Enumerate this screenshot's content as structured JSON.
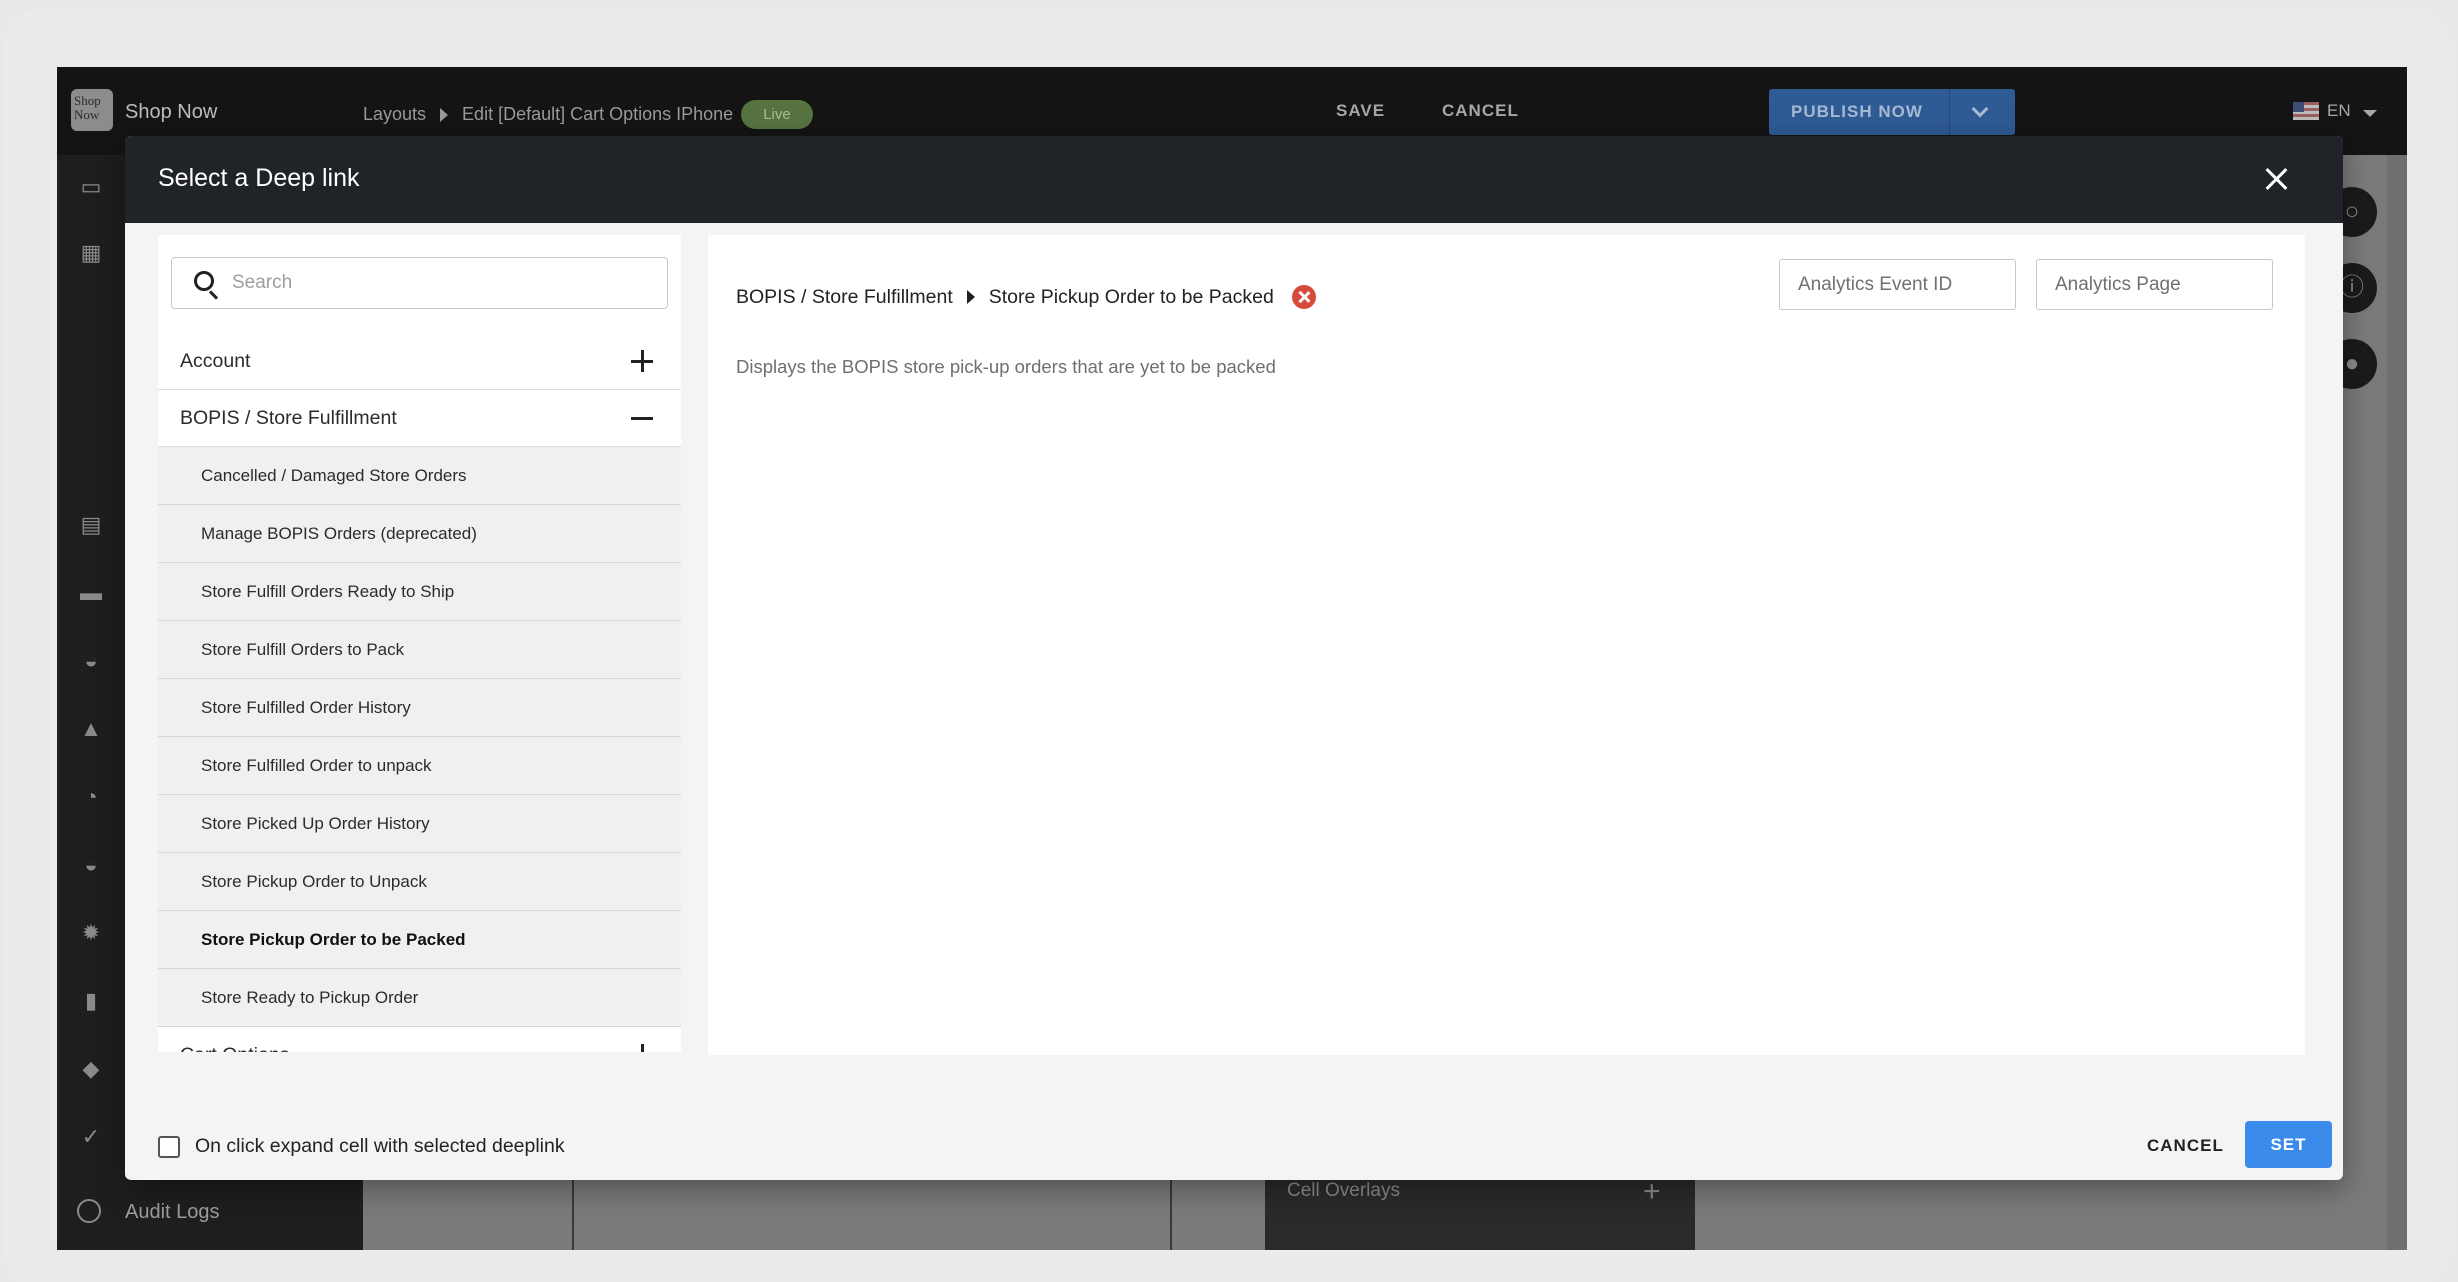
{
  "app": {
    "brand_logo_text": "Shop Now",
    "brand_name": "Shop Now",
    "breadcrumb": [
      "Layouts",
      "Edit [Default] Cart Options IPhone"
    ],
    "live_badge": "Live",
    "publish_label": "PUBLISH NOW",
    "save_label": "SAVE",
    "cancel_label": "CANCEL",
    "language": "EN",
    "sidebar_bottom_label": "Audit Logs",
    "background_panel_label": "Cell Overlays"
  },
  "modal": {
    "title": "Select a Deep link",
    "search_placeholder": "Search",
    "groups": [
      {
        "label": "Account",
        "expanded": false
      },
      {
        "label": "BOPIS / Store Fulfillment",
        "expanded": true
      },
      {
        "label": "Cart Options",
        "expanded": false
      }
    ],
    "sub_items": [
      "Cancelled / Damaged Store Orders",
      "Manage BOPIS Orders (deprecated)",
      "Store Fulfill Orders Ready to Ship",
      "Store Fulfill Orders to Pack",
      "Store Fulfilled Order History",
      "Store Fulfilled Order to unpack",
      "Store Picked Up Order History",
      "Store Pickup Order to Unpack",
      "Store Pickup Order to be Packed",
      "Store Ready to Pickup Order"
    ],
    "selected_item": "Store Pickup Order to be Packed",
    "selected_path": {
      "category": "BOPIS / Store Fulfillment",
      "item": "Store Pickup Order to be Packed"
    },
    "description": "Displays the BOPIS store pick-up orders that are yet to be packed",
    "analytics_event_placeholder": "Analytics Event ID",
    "analytics_page_placeholder": "Analytics Page",
    "expand_checkbox_label": "On click expand cell with selected deeplink",
    "expand_checkbox_checked": false,
    "cancel_label": "CANCEL",
    "set_label": "SET",
    "colors": {
      "header_bg": "#202428",
      "set_button": "#3b8bea",
      "clear_icon": "#d64a3c",
      "live_badge": "#57733f",
      "publish_button": "#2f5b95"
    }
  }
}
